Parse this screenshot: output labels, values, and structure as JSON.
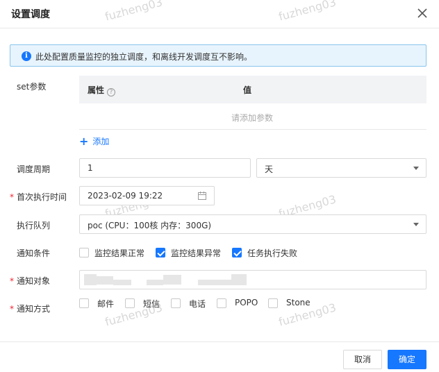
{
  "dialog": {
    "title": "设置调度",
    "close_icon": "close-icon"
  },
  "watermark": "fuzheng03",
  "alert": {
    "icon": "info-icon",
    "text": "此处配置质量监控的独立调度，和离线开发调度互不影响。"
  },
  "set_params": {
    "label": "set参数",
    "columns": [
      "属性",
      "值"
    ],
    "help_icon": "question-circle-icon",
    "empty_text": "请添加参数",
    "add_label": "添加"
  },
  "schedule_period": {
    "label": "调度周期",
    "value": "1",
    "unit": "天"
  },
  "first_run": {
    "label": "首次执行时间",
    "value": "2023-02-09 19:22",
    "icon": "calendar-icon"
  },
  "queue": {
    "label": "执行队列",
    "value": "poc (CPU：100核 内存：300G)"
  },
  "notify_condition": {
    "label": "通知条件",
    "options": [
      {
        "label": "监控结果正常",
        "checked": false
      },
      {
        "label": "监控结果异常",
        "checked": true
      },
      {
        "label": "任务执行失败",
        "checked": true
      }
    ]
  },
  "notify_target": {
    "label": "通知对象"
  },
  "notify_method": {
    "label": "通知方式",
    "options": [
      {
        "label": "邮件",
        "checked": false
      },
      {
        "label": "短信",
        "checked": false
      },
      {
        "label": "电话",
        "checked": false
      },
      {
        "label": "POPO",
        "checked": false
      },
      {
        "label": "Stone",
        "checked": false
      }
    ]
  },
  "footer": {
    "cancel_label": "取消",
    "ok_label": "确定"
  },
  "colors": {
    "primary": "#1677ff",
    "required": "#f5222d",
    "alert_bg": "#e8f4fd"
  }
}
